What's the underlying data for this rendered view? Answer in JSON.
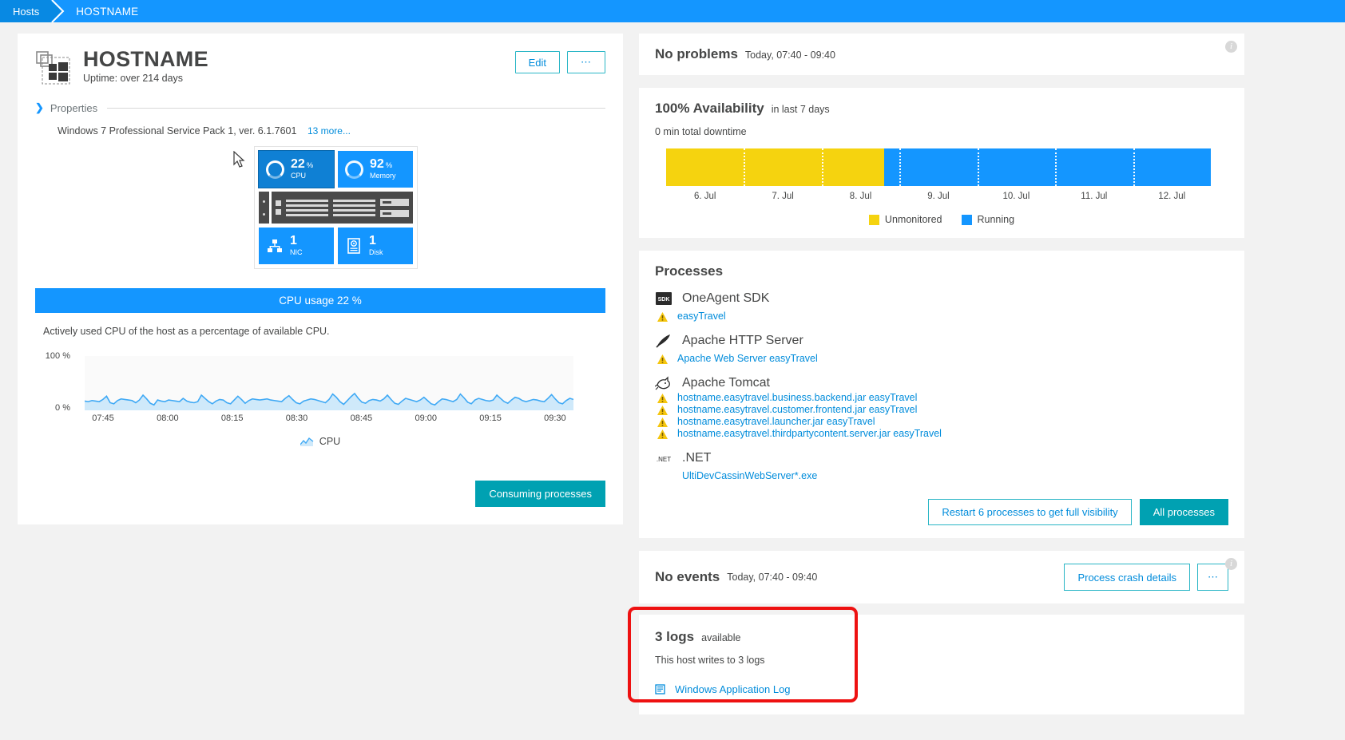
{
  "breadcrumb": {
    "root": "Hosts",
    "current": "HOSTNAME"
  },
  "host": {
    "title": "HOSTNAME",
    "uptime": "Uptime: over 214 days",
    "edit_label": "Edit",
    "more_label": "⋯",
    "properties_label": "Properties",
    "os": "Windows 7 Professional Service Pack 1, ver. 6.1.7601",
    "more_props": "13 more...",
    "tiles": [
      {
        "value": "22",
        "unit": "%",
        "name": "CPU",
        "icon": "donut-icon"
      },
      {
        "value": "92",
        "unit": "%",
        "name": "Memory",
        "icon": "donut-icon"
      },
      {
        "value": "1",
        "unit": "",
        "name": "NIC",
        "icon": "network-icon"
      },
      {
        "value": "1",
        "unit": "",
        "name": "Disk",
        "icon": "disk-icon"
      }
    ],
    "cpu_banner": "CPU usage 22 %",
    "cpu_description": "Actively used CPU of the host as a percentage of available CPU.",
    "consuming_button": "Consuming processes"
  },
  "chart_data": {
    "type": "area",
    "title": "CPU usage 22 %",
    "xlabel": "",
    "ylabel": "",
    "ylim": [
      0,
      100
    ],
    "ytick_labels": [
      "100 %",
      "0 %"
    ],
    "legend": [
      "CPU"
    ],
    "legend_position": "bottom-center",
    "grid": false,
    "categories": [
      "07:45",
      "08:00",
      "08:15",
      "08:30",
      "08:45",
      "09:00",
      "09:15",
      "09:30"
    ],
    "series": [
      {
        "name": "CPU",
        "color": "#3fa9f5",
        "values": [
          17,
          16,
          18,
          17,
          16,
          20,
          26,
          14,
          12,
          18,
          21,
          20,
          19,
          18,
          14,
          19,
          28,
          21,
          13,
          10,
          19,
          17,
          16,
          19,
          18,
          17,
          16,
          22,
          17,
          15,
          14,
          16,
          28,
          22,
          16,
          12,
          17,
          20,
          19,
          14,
          12,
          19,
          26,
          20,
          13,
          18,
          21,
          20,
          19,
          20,
          21,
          19,
          18,
          17,
          16,
          22,
          27,
          20,
          14,
          12,
          17,
          19,
          21,
          20,
          18,
          16,
          14,
          20,
          30,
          24,
          16,
          11,
          18,
          25,
          31,
          22,
          15,
          13,
          18,
          20,
          19,
          17,
          21,
          28,
          20,
          13,
          11,
          17,
          22,
          20,
          18,
          16,
          19,
          24,
          18,
          12,
          10,
          16,
          21,
          20,
          18,
          16,
          20,
          30,
          23,
          15,
          12,
          19,
          22,
          20,
          18,
          17,
          19,
          28,
          22,
          16,
          13,
          19,
          24,
          22,
          18,
          16,
          18,
          20,
          19,
          17,
          16,
          22,
          29,
          21,
          14,
          12,
          18,
          22,
          20
        ]
      }
    ]
  },
  "problems": {
    "title": "No problems",
    "timeframe": "Today, 07:40 - 09:40",
    "info_glyph": "i"
  },
  "availability": {
    "title": "100% Availability",
    "subtitle": "in last 7 days",
    "downtime": "0 min total downtime",
    "timeline": [
      {
        "state": "Unmonitored",
        "color": "#f5d30f",
        "width_pct": 40
      },
      {
        "state": "Running",
        "color": "#1496ff",
        "width_pct": 60
      }
    ],
    "ticks": [
      "6. Jul",
      "7. Jul",
      "8. Jul",
      "9. Jul",
      "10. Jul",
      "11. Jul",
      "12. Jul"
    ],
    "legend": [
      {
        "label": "Unmonitored",
        "color": "#f5d30f"
      },
      {
        "label": "Running",
        "color": "#1496ff"
      }
    ]
  },
  "processes": {
    "title": "Processes",
    "groups": [
      {
        "name": "OneAgent SDK",
        "icon": "sdk-icon",
        "items": [
          {
            "label": "easyTravel",
            "warning": true
          }
        ]
      },
      {
        "name": "Apache HTTP Server",
        "icon": "feather-icon",
        "items": [
          {
            "label": "Apache Web Server easyTravel",
            "warning": true
          }
        ]
      },
      {
        "name": "Apache Tomcat",
        "icon": "tomcat-icon",
        "items": [
          {
            "label": "hostname.easytravel.business.backend.jar easyTravel",
            "warning": true
          },
          {
            "label": "hostname.easytravel.customer.frontend.jar easyTravel",
            "warning": true
          },
          {
            "label": "hostname.easytravel.launcher.jar easyTravel",
            "warning": true
          },
          {
            "label": "hostname.easytravel.thirdpartycontent.server.jar easyTravel",
            "warning": true
          }
        ]
      },
      {
        "name": ".NET",
        "icon": "dotnet-icon",
        "items": [
          {
            "label": "UltiDevCassinWebServer*.exe",
            "warning": false
          }
        ]
      }
    ],
    "restart_button": "Restart 6 processes to get full visibility",
    "all_button": "All processes"
  },
  "events": {
    "title": "No events",
    "timeframe": "Today, 07:40 - 09:40",
    "crash_button": "Process crash details",
    "more_button": "⋯",
    "info_glyph": "i"
  },
  "logs": {
    "count_title": "3 logs",
    "available_label": "available",
    "description": "This host writes to 3 logs",
    "items": [
      {
        "label": "Windows Application Log",
        "icon": "log-file-icon"
      }
    ],
    "highlight_color": "#ee1111"
  }
}
